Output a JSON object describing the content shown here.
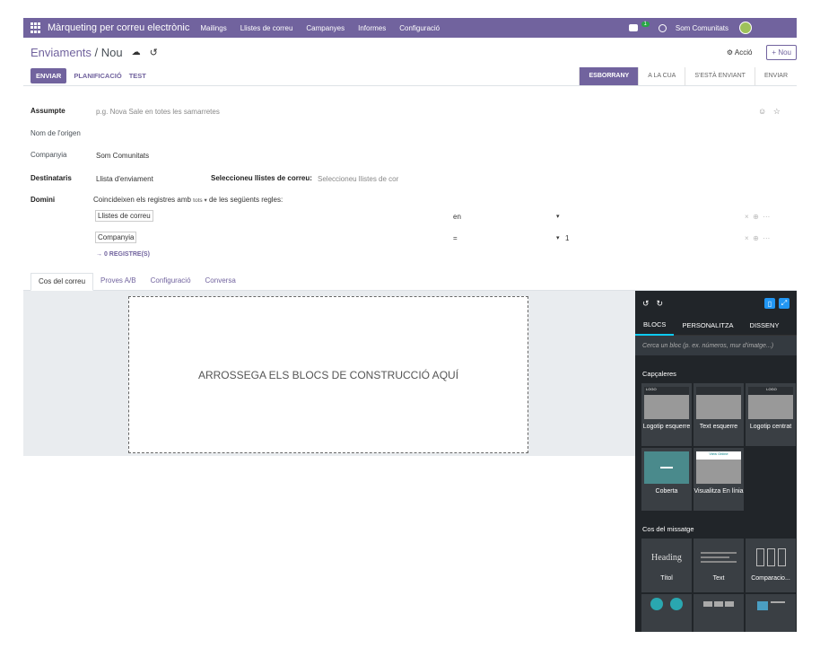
{
  "navbar": {
    "brand": "Màrqueting per correu electrònic",
    "menu": [
      "Mailings",
      "Llistes de correu",
      "Campanyes",
      "Informes",
      "Configuració"
    ],
    "badge": "1",
    "company": "Som Comunitats"
  },
  "control": {
    "breadcrumb_parent": "Enviaments",
    "breadcrumb_sep": " / ",
    "breadcrumb_current": "Nou",
    "action": "⚙ Acció",
    "new_button": "+ Nou"
  },
  "statusbar": {
    "send": "ENVIAR",
    "schedule": "PLANIFICACIÓ",
    "test": "TEST",
    "stages": [
      "ESBORRANY",
      "A LA CUA",
      "S'ESTÀ ENVIANT",
      "ENVIAR"
    ]
  },
  "form": {
    "subject_label": "Assumpte",
    "subject_placeholder": "p.g. Nova Sale en totes les samarretes",
    "from_label": "Nom de l'origen",
    "company_label": "Companyia",
    "company_value": "Som Comunitats",
    "recipients_label": "Destinataris",
    "recipients_value": "Llista d'enviament",
    "lists_label": "Seleccioneu llistes de correu:",
    "lists_placeholder": "Seleccioneu llistes de cor",
    "domain_label": "Domini",
    "domain_text_1": "Coincideixen els registres amb",
    "domain_all": "tots ▾",
    "domain_text_2": "de les següents regles:",
    "rules": [
      {
        "field": "Llistes de correu",
        "op": "en",
        "value": ""
      },
      {
        "field": "Companyia",
        "op": "=",
        "value": "1"
      }
    ],
    "records": "→  0 REGISTRE(S)"
  },
  "tabs": [
    "Cos del correu",
    "Proves A/B",
    "Configuració",
    "Conversa"
  ],
  "editor": {
    "dropzone": "ARROSSEGA ELS BLOCS DE CONSTRUCCIÓ AQUÍ"
  },
  "sidebar": {
    "tabs": [
      "BLOCS",
      "PERSONALITZA",
      "DISSENY"
    ],
    "search_placeholder": "Cerca un bloc (p. ex. números, mur d'imatge...)",
    "section_headers": "Capçaleres",
    "section_body": "Cos del missatge",
    "header_blocks": [
      "Logotip esquerre",
      "Text esquerre",
      "Logotip centrat",
      "Coberta",
      "Visualitza En línia"
    ],
    "view_online": "View Online",
    "thumb_logo": "LOGO",
    "body_blocks": [
      "Títol",
      "Text",
      "Comparacio..."
    ],
    "heading_thumb": "Heading"
  }
}
